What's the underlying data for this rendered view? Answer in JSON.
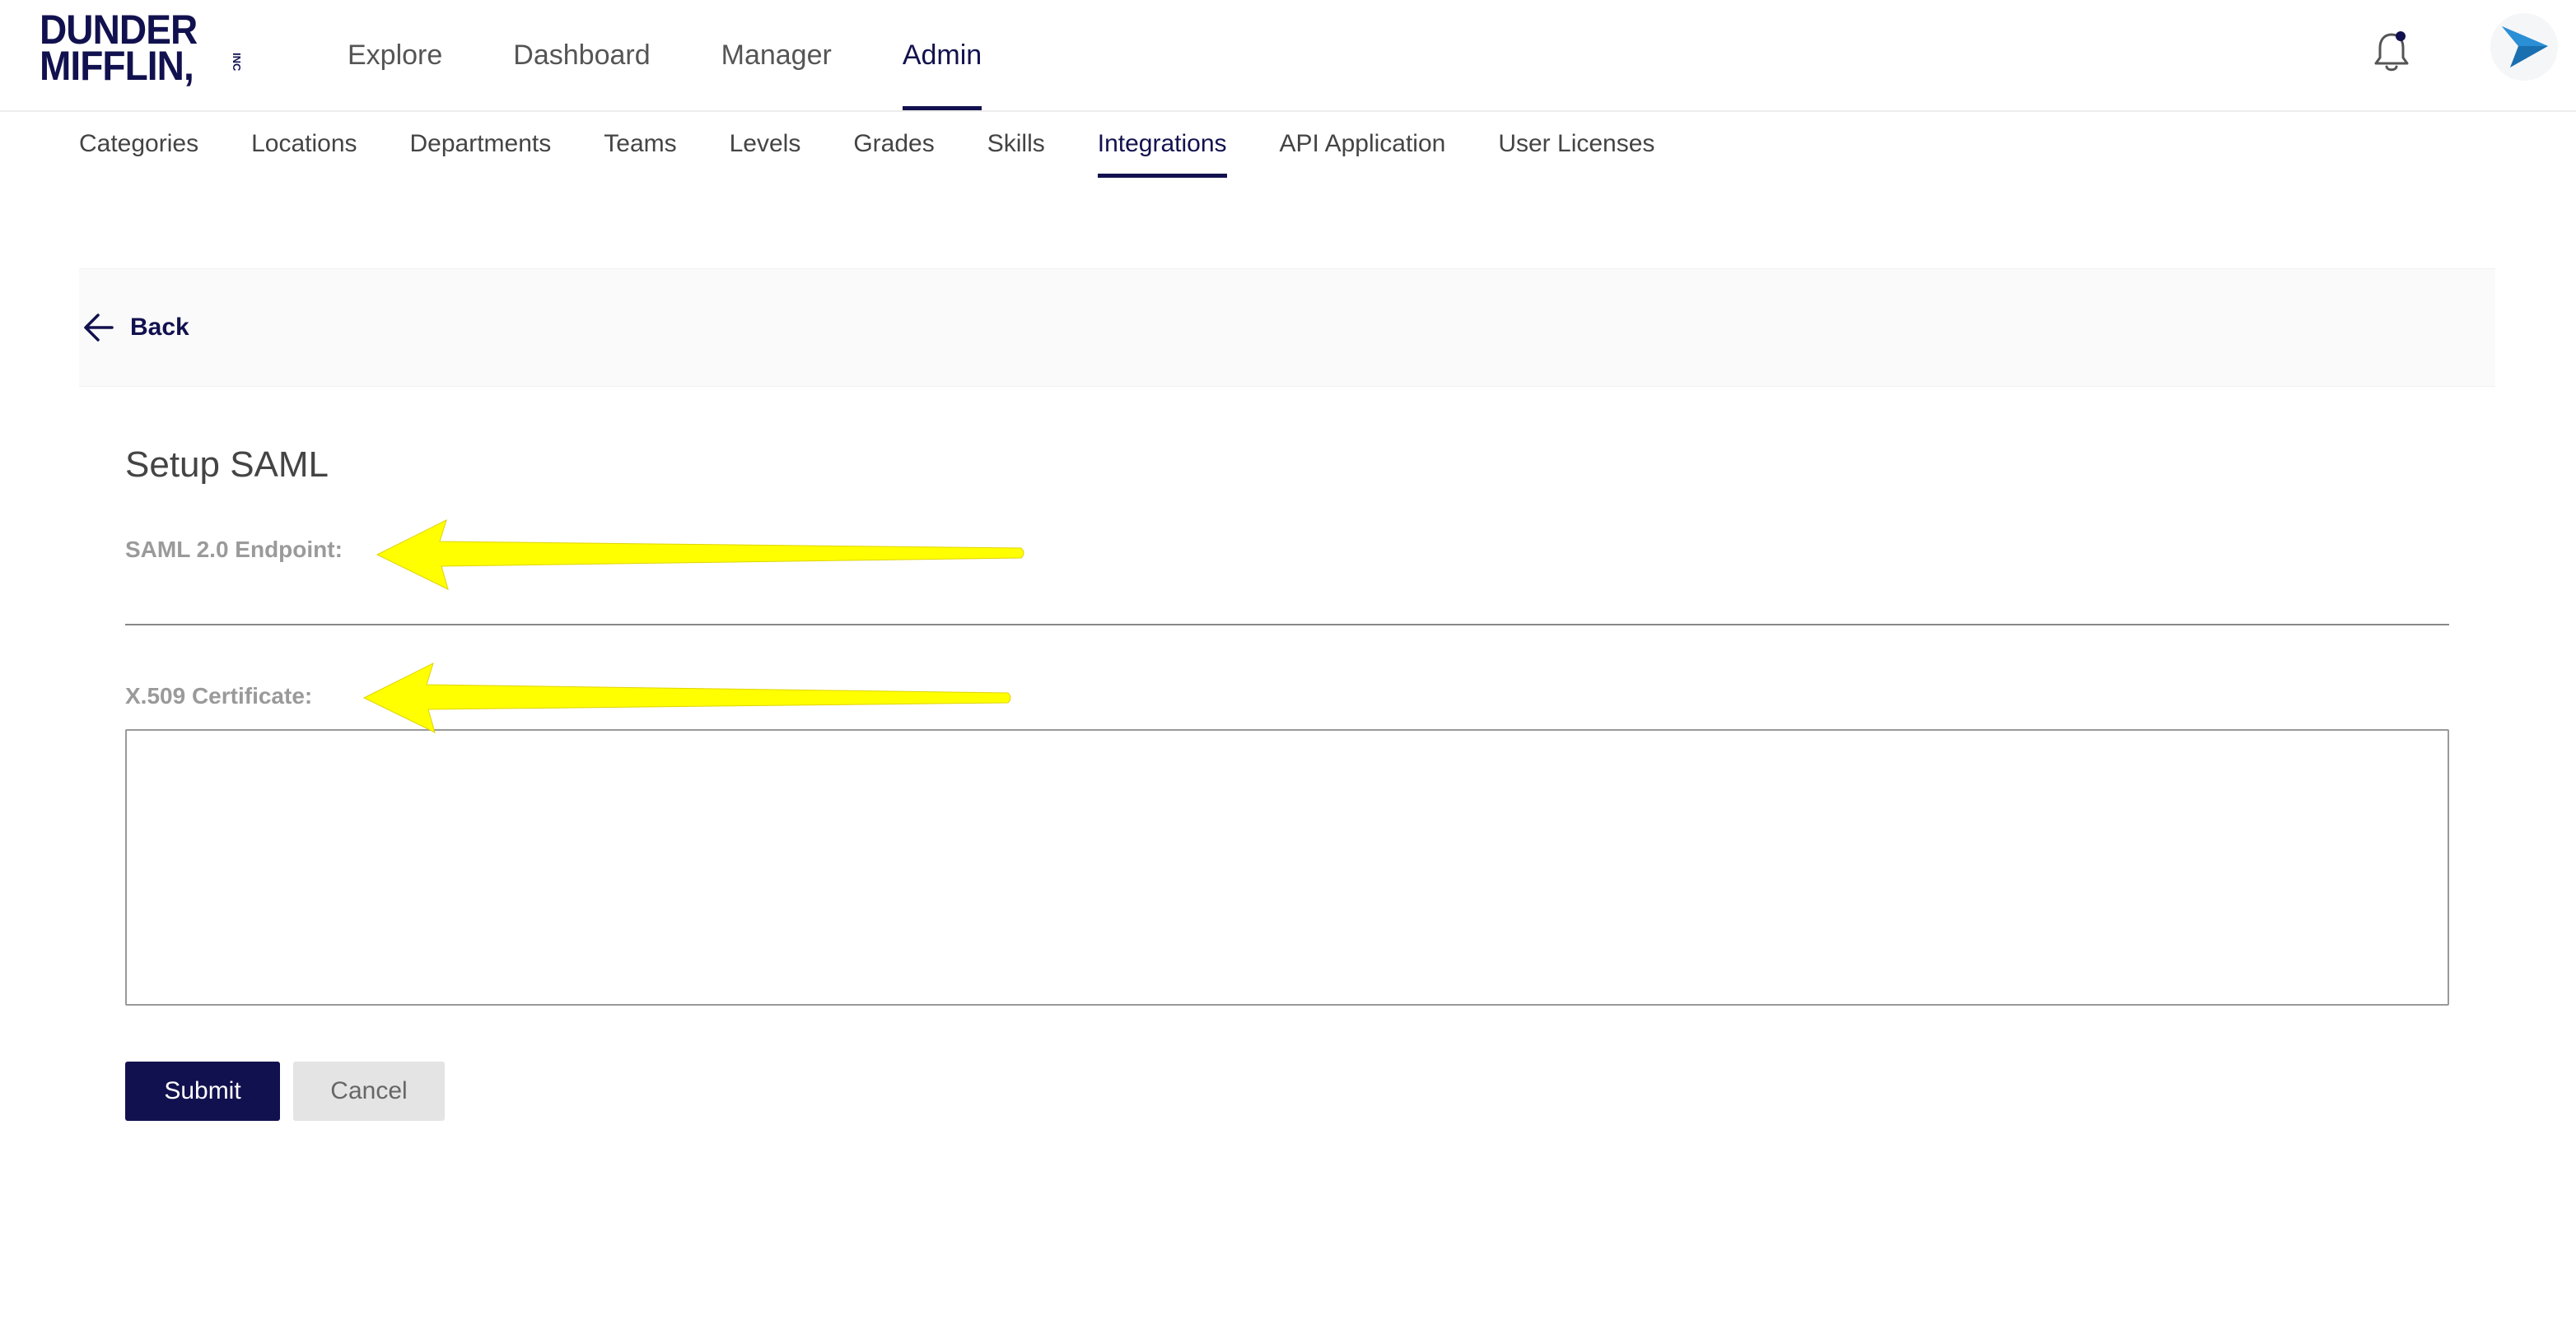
{
  "brand": {
    "logo_line1": "DUNDER",
    "logo_line2": "MIFFLIN,",
    "logo_inc": "INC"
  },
  "main_nav": [
    {
      "label": "Explore"
    },
    {
      "label": "Dashboard"
    },
    {
      "label": "Manager"
    },
    {
      "label": "Admin",
      "active": true
    }
  ],
  "sub_nav": [
    {
      "label": "Categories"
    },
    {
      "label": "Locations"
    },
    {
      "label": "Departments"
    },
    {
      "label": "Teams"
    },
    {
      "label": "Levels"
    },
    {
      "label": "Grades"
    },
    {
      "label": "Skills"
    },
    {
      "label": "Integrations",
      "active": true
    },
    {
      "label": "API Application"
    },
    {
      "label": "User Licenses"
    }
  ],
  "back": {
    "label": "Back",
    "icon": "arrow-left-icon"
  },
  "form": {
    "title": "Setup SAML",
    "endpoint_label": "SAML 2.0 Endpoint:",
    "endpoint_value": "",
    "certificate_label": "X.509 Certificate:",
    "certificate_value": "",
    "submit_label": "Submit",
    "cancel_label": "Cancel"
  },
  "icons": {
    "notifications": "bell-icon",
    "avatar": "avatar-icon"
  },
  "colors": {
    "brand_navy": "#12114f",
    "annotation_yellow": "#ffff00",
    "avatar_blue": "#1a6fb0"
  }
}
